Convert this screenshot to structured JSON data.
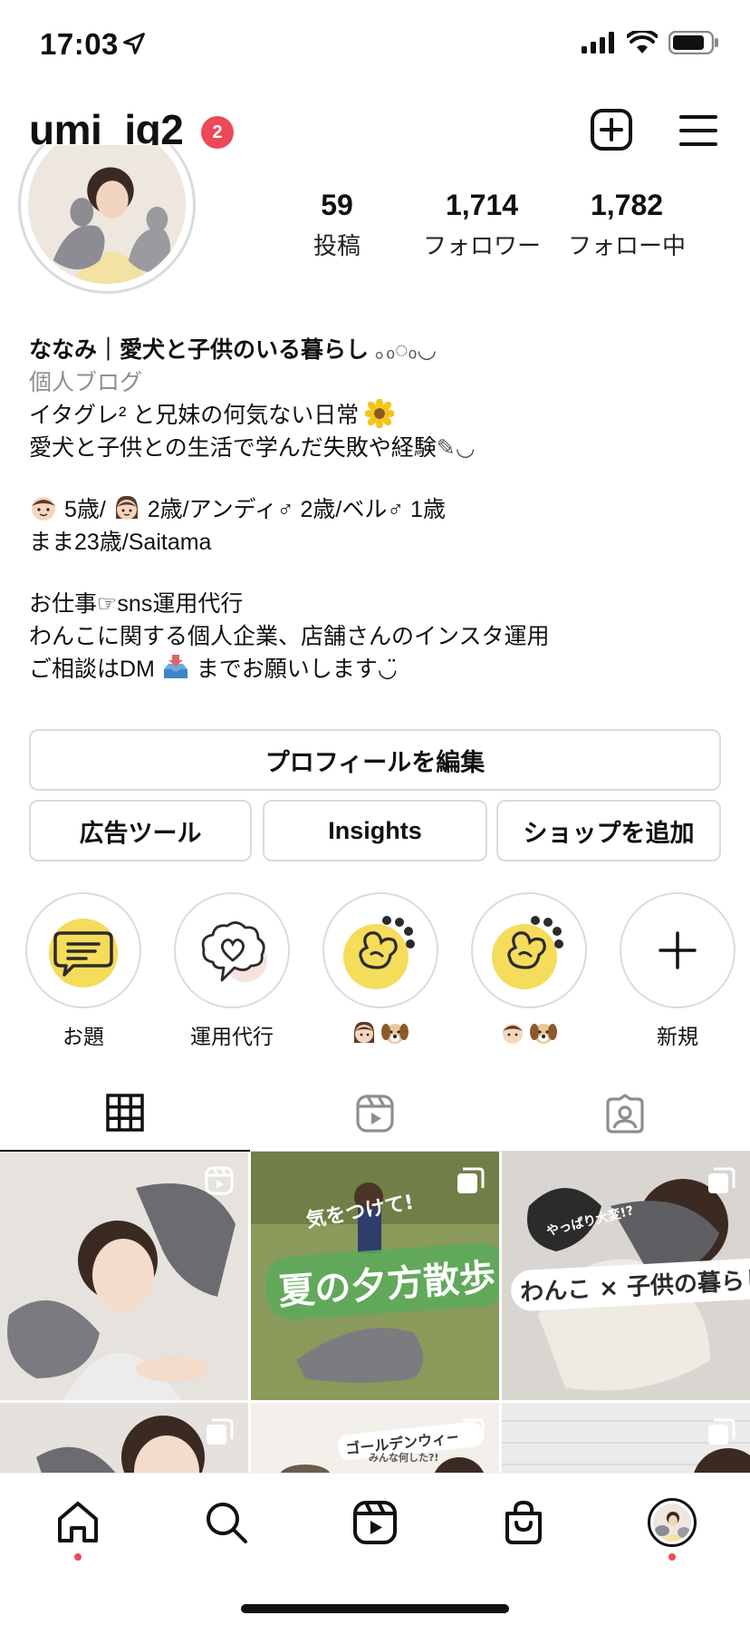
{
  "status_bar": {
    "time": "17:03"
  },
  "header": {
    "username": "umi_ig2",
    "notification_count": "2"
  },
  "stats": [
    {
      "value": "59",
      "label": "投稿"
    },
    {
      "value": "1,714",
      "label": "フォロワー"
    },
    {
      "value": "1,782",
      "label": "フォロー中"
    }
  ],
  "bio": {
    "name": "ななみ｜愛犬と子供のいる暮らし",
    "name_deco": "｡ₒ◌ₒ◡",
    "category": "個人ブログ",
    "line1": "イタグレ² と兄妹の何気ない日常",
    "line2": "愛犬と子供との生活で学んだ失敗や経験",
    "line2_suffix": "✎◡",
    "line3_a": "5歳/",
    "line3_b": "2歳/アンディ♂ 2歳/ベル♂ 1歳",
    "line4": "まま23歳/Saitama",
    "line5": "お仕事☞sns運用代行",
    "line6": "わんこに関する個人企業、店舗さんのインスタ運用",
    "line7_a": "ご相談はDM",
    "line7_b": "までお願いします",
    "line7_c": "◡̈"
  },
  "buttons": {
    "edit_profile": "プロフィールを編集",
    "ad_tools": "広告ツール",
    "insights": "Insights",
    "add_shop": "ショップを追加"
  },
  "highlights": [
    {
      "label": "お題",
      "icon": "chat-bubble-icon"
    },
    {
      "label": "運用代行",
      "icon": "heart-cloud-icon"
    },
    {
      "label": "",
      "icon": "dog-paw-icon"
    },
    {
      "label": "",
      "icon": "dog-paw-icon"
    },
    {
      "label": "新規",
      "icon": "plus-icon"
    }
  ],
  "posts": [
    {
      "type": "reel",
      "title": ""
    },
    {
      "type": "carousel",
      "title": "夏の夕方散歩",
      "subtitle": "気をつけて!"
    },
    {
      "type": "carousel",
      "title": "わんこ × 子供の暮らし",
      "subtitle": "やっぱり大変!?"
    },
    {
      "type": "carousel",
      "title": ""
    },
    {
      "type": "carousel",
      "title": "ゴールデンウィーク",
      "subtitle": "みんな何した?!"
    },
    {
      "type": "carousel",
      "title": ""
    }
  ],
  "colors": {
    "accent_red": "#ed4956",
    "border": "#dbdbdb",
    "highlight_yellow": "#f5dc5a"
  }
}
